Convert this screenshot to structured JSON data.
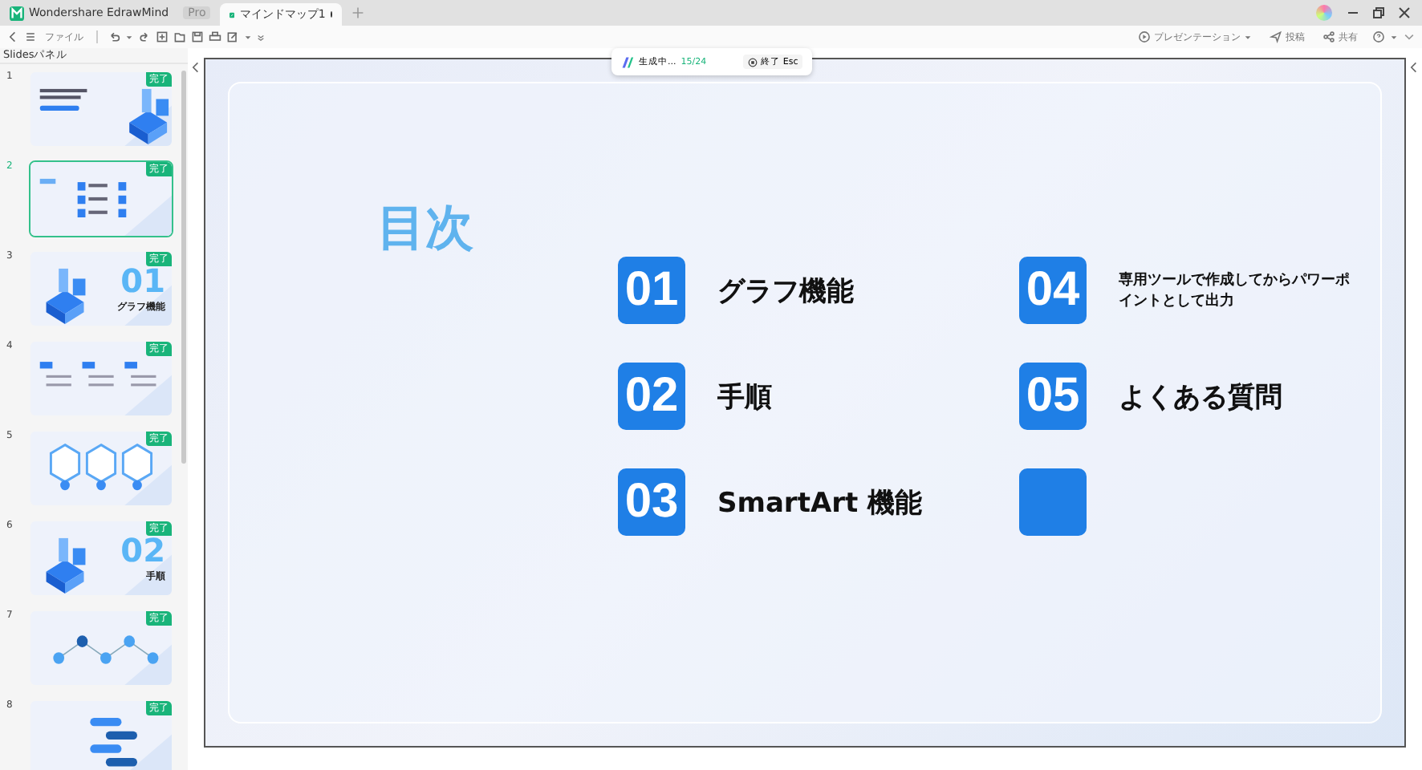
{
  "app_tab": {
    "title": "Wondershare EdrawMind",
    "badge": "Pro"
  },
  "doc_tabs": [
    {
      "title": "マインドマップ1",
      "selected": true,
      "modified": true
    }
  ],
  "toolbar": {
    "file_menu": "ファイル",
    "right": [
      {
        "kind": "play",
        "label": "プレゼンテーション"
      },
      {
        "kind": "send",
        "label": "投稿"
      },
      {
        "kind": "share",
        "label": "共有"
      }
    ]
  },
  "sidebar": {
    "title": "Slidesパネル",
    "slides": [
      {
        "number": "1",
        "kind": "cover",
        "status": "完了",
        "selected": false
      },
      {
        "number": "2",
        "kind": "toc",
        "status": "完了",
        "selected": true
      },
      {
        "number": "3",
        "kind": "section",
        "status": "完了",
        "selected": false,
        "big": "01",
        "heading": "グラフ機能"
      },
      {
        "number": "4",
        "kind": "columns",
        "status": "完了",
        "selected": false
      },
      {
        "number": "5",
        "kind": "hexagons",
        "status": "完了",
        "selected": false
      },
      {
        "number": "6",
        "kind": "section",
        "status": "完了",
        "selected": false,
        "big": "02",
        "heading": "手順"
      },
      {
        "number": "7",
        "kind": "flow",
        "status": "完了",
        "selected": false
      },
      {
        "number": "8",
        "kind": "steps",
        "status": "完了",
        "selected": false
      }
    ]
  },
  "progress": {
    "label": "生成中...",
    "count": "15/24",
    "stop_button": "終了 Esc"
  },
  "slide": {
    "title": "目次",
    "items": [
      {
        "kind": "entry",
        "number": "01",
        "label": "グラフ機能"
      },
      {
        "kind": "entry",
        "number": "02",
        "label": "手順"
      },
      {
        "kind": "entry",
        "number": "03",
        "label": "SmartArt 機能"
      },
      {
        "kind": "entry",
        "number": "04",
        "label": "専用ツールで作成してからパワーポイントとして出力"
      },
      {
        "kind": "entry",
        "number": "05",
        "label": "よくある質問"
      },
      {
        "kind": "blank"
      }
    ]
  }
}
